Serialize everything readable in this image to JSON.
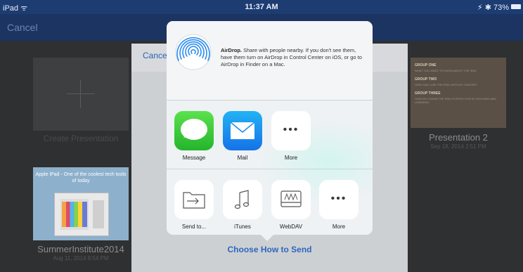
{
  "status_bar": {
    "left": "iPad ᯤ",
    "time": "11:37 AM",
    "right": "⚡︎ ✱ 73%"
  },
  "nav": {
    "cancel": "Cancel"
  },
  "library": {
    "create": {
      "label": "Create Presentation"
    },
    "presentation2": {
      "title": "Presentation 2",
      "date": "Sep 18, 2014 2:51 PM",
      "slide": [
        {
          "heading": "GROUP ONE",
          "sub": "WHAT YOU WANT TO KNOW ABOUT THE IPAD"
        },
        {
          "heading": "GROUP TWO",
          "sub": "HOW CAN I USE THE IPAD WITH MY CONTENT"
        },
        {
          "heading": "GROUP THREE",
          "sub": "HOW DO I KNOW THE IPAD IS EFFECTIVE IN TEACHING AND LEARNING"
        }
      ]
    },
    "summer": {
      "title": "SummerInstitute2014",
      "date": "Aug 11, 2014 8:54 PM",
      "slide_text": "Apple iPad - One of the coolest tech tools of today"
    }
  },
  "sheet": {
    "cancel": "Cance",
    "footer": "Choose How to Send"
  },
  "share": {
    "airdrop_title": "AirDrop.",
    "airdrop_body": " Share with people nearby. If you don't see them, have them turn on AirDrop in Control Center on iOS, or go to AirDrop in Finder on a Mac.",
    "apps": [
      {
        "label": "Message",
        "icon": "message-icon"
      },
      {
        "label": "Mail",
        "icon": "mail-icon"
      },
      {
        "label": "More",
        "icon": "more-icon"
      }
    ],
    "actions": [
      {
        "label": "Send to...",
        "icon": "folder-send-icon"
      },
      {
        "label": "iTunes",
        "icon": "music-note-icon"
      },
      {
        "label": "WebDAV",
        "icon": "webdav-drive-icon"
      },
      {
        "label": "More",
        "icon": "more-icon"
      }
    ]
  },
  "colors": {
    "nav": "#1b3461",
    "status": "#1d3c72",
    "accent": "#2c67bd",
    "background": "#2f3032"
  }
}
